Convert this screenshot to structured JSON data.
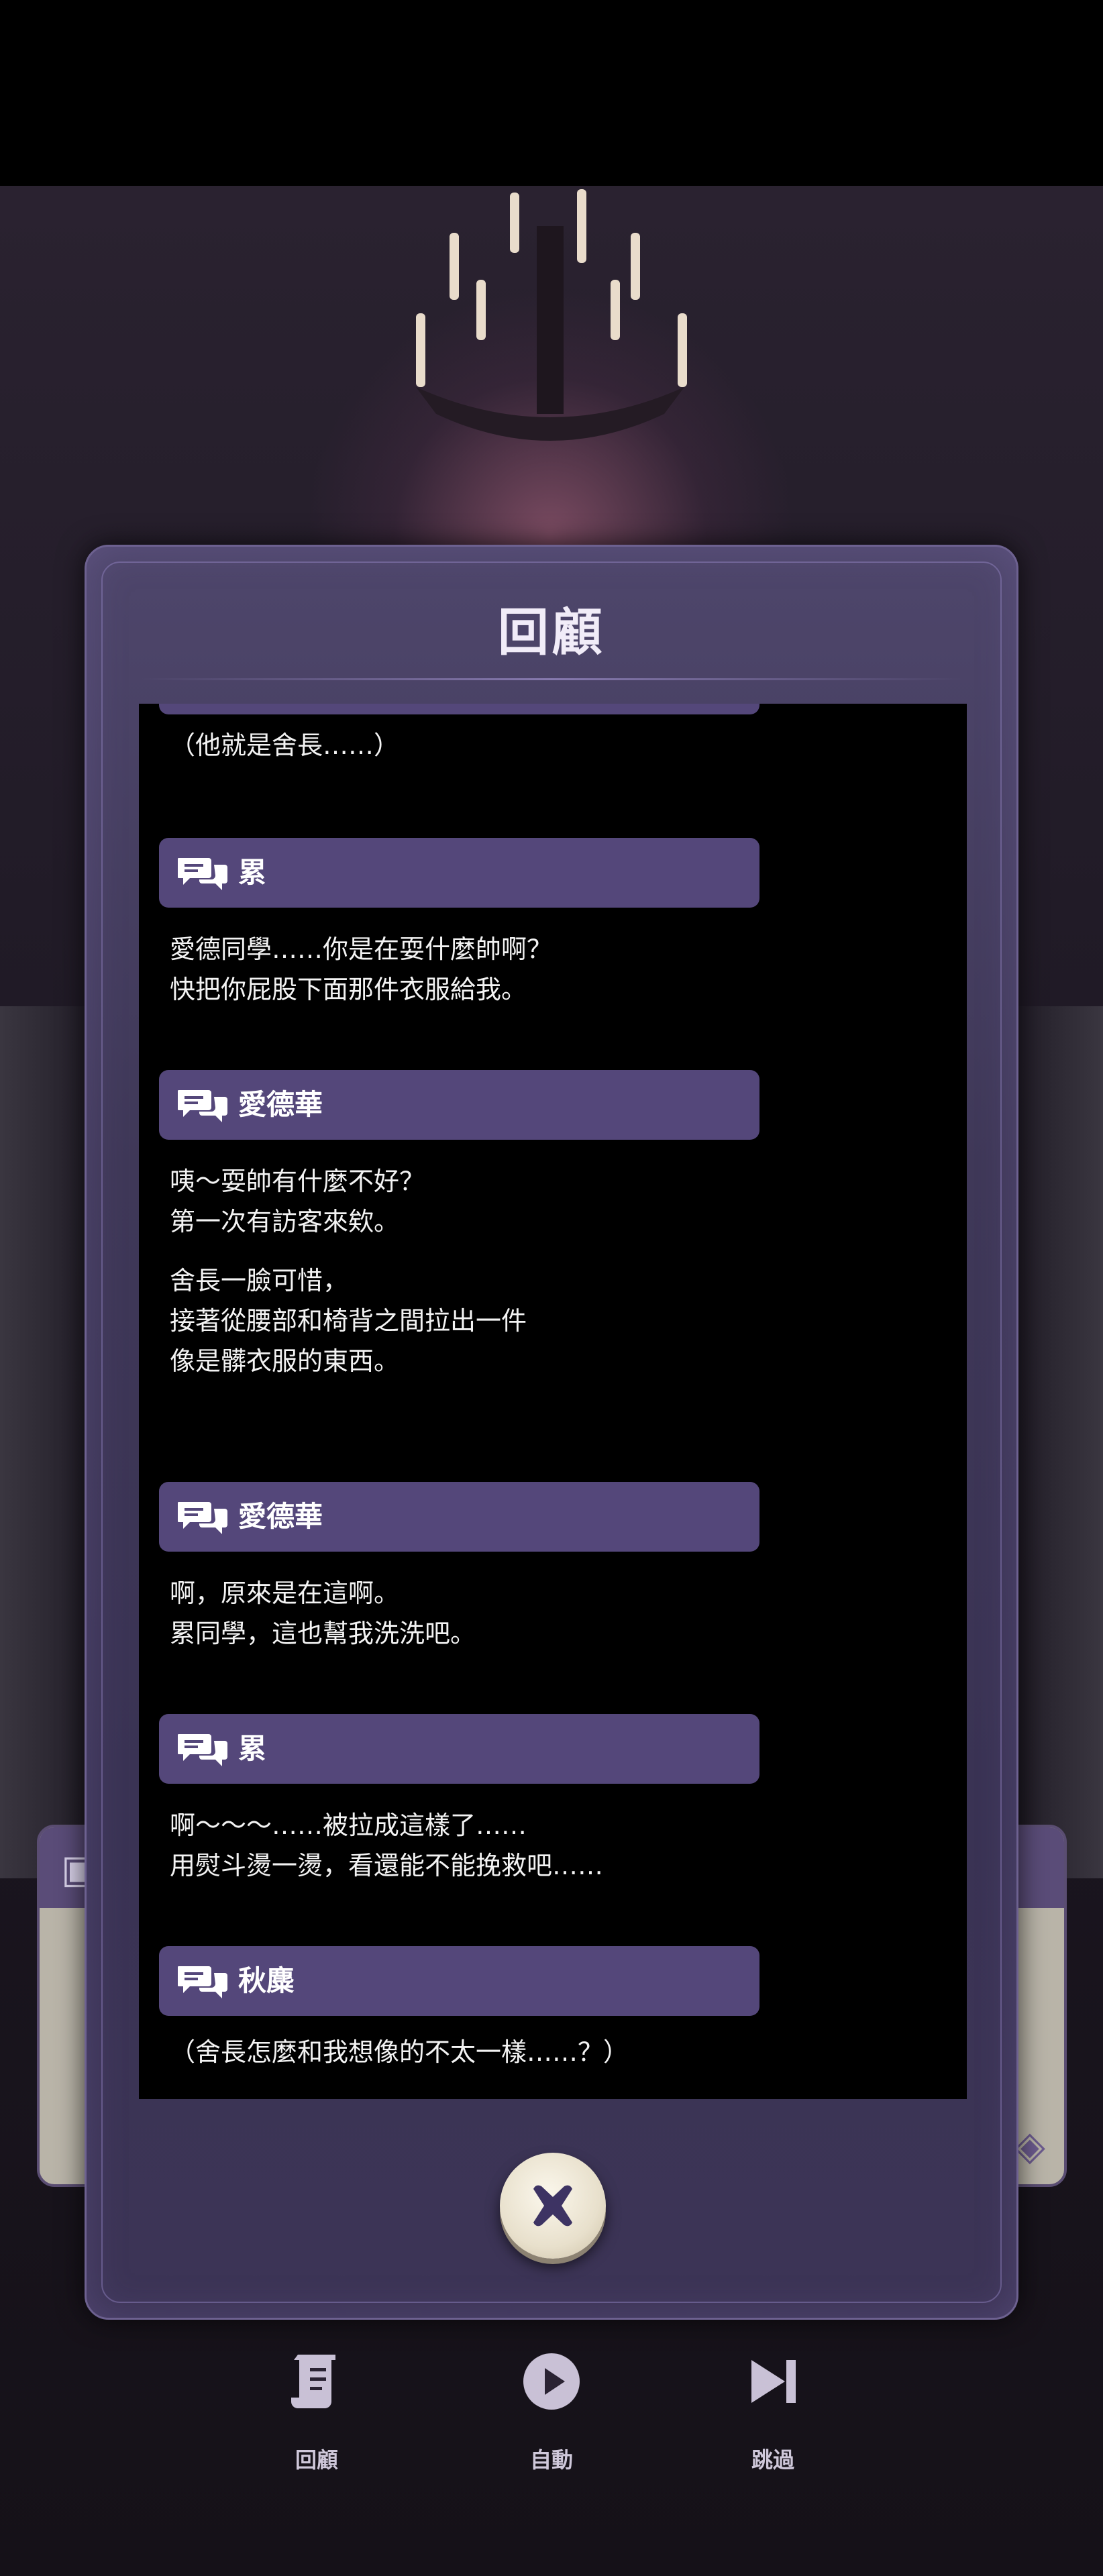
{
  "backlog": {
    "title": "回顧",
    "entries": [
      {
        "speaker": "",
        "text": "（他就是舍長……）"
      },
      {
        "speaker": "累",
        "text": "愛德同學……你是在耍什麼帥啊？\n快把你屁股下面那件衣服給我。"
      },
      {
        "speaker": "愛德華",
        "text": "咦～耍帥有什麼不好？\n第一次有訪客來欸。"
      },
      {
        "speaker": "",
        "text": "舍長一臉可惜，\n接著從腰部和椅背之間拉出一件\n像是髒衣服的東西。"
      },
      {
        "speaker": "愛德華",
        "text": "啊，原來是在這啊。\n累同學，這也幫我洗洗吧。"
      },
      {
        "speaker": "累",
        "text": "啊～～～……被拉成這樣了……\n用熨斗燙一燙，看還能不能挽救吧……"
      },
      {
        "speaker": "秋麋",
        "text": "（舍長怎麼和我想像的不太一樣……？）"
      }
    ],
    "close_icon": "close-x-icon"
  },
  "toolbar": {
    "backlog_label": "回顧",
    "auto_label": "自動",
    "skip_label": "跳過"
  },
  "colors": {
    "modal_bg": "#3f3858",
    "name_bar": "#54477a",
    "log_bg": "#000000",
    "text": "#f3f3f3"
  }
}
